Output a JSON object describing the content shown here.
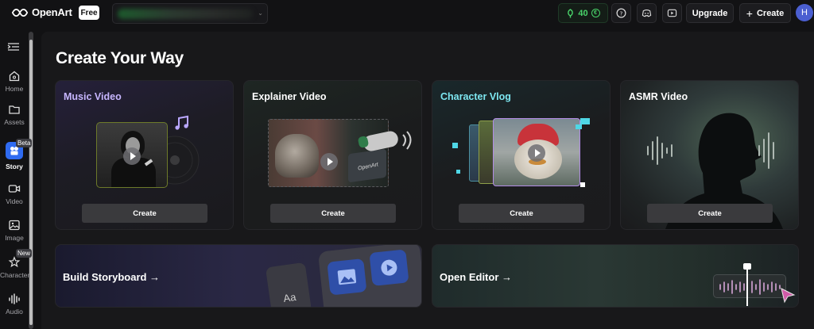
{
  "app": {
    "name": "OpenArt",
    "plan_badge": "Free"
  },
  "topbar": {
    "credits": "40",
    "credits_icon": "€",
    "help_icon": "?",
    "upgrade_label": "Upgrade",
    "create_label": "Create",
    "create_icon": "+",
    "avatar_initial": "H",
    "workspace_caret": "⌄"
  },
  "sidebar": {
    "items": [
      {
        "label": "Home",
        "icon": "home-icon"
      },
      {
        "label": "Assets",
        "icon": "folder-icon"
      },
      {
        "label": "Story",
        "icon": "story-icon",
        "badge": "Beta"
      },
      {
        "label": "Video",
        "icon": "video-icon"
      },
      {
        "label": "Image",
        "icon": "image-icon"
      },
      {
        "label": "Character",
        "icon": "character-icon",
        "badge": "New"
      },
      {
        "label": "Audio",
        "icon": "audio-icon"
      }
    ]
  },
  "main": {
    "title": "Create Your Way",
    "cards": [
      {
        "title": "Music Video",
        "button": "Create"
      },
      {
        "title": "Explainer Video",
        "button": "Create",
        "thumb_text": "OpenArt"
      },
      {
        "title": "Character Vlog",
        "button": "Create"
      },
      {
        "title": "ASMR Video",
        "button": "Create"
      }
    ],
    "wide_cards": [
      {
        "title": "Build Storyboard →",
        "tile_text": "Aa"
      },
      {
        "title": "Open Editor →"
      }
    ]
  },
  "colors": {
    "music_video_title": "#c7b6ff",
    "character_vlog_title": "#7de6f0",
    "credits_green": "#49d36a",
    "story_blue": "#2f6bf1"
  }
}
